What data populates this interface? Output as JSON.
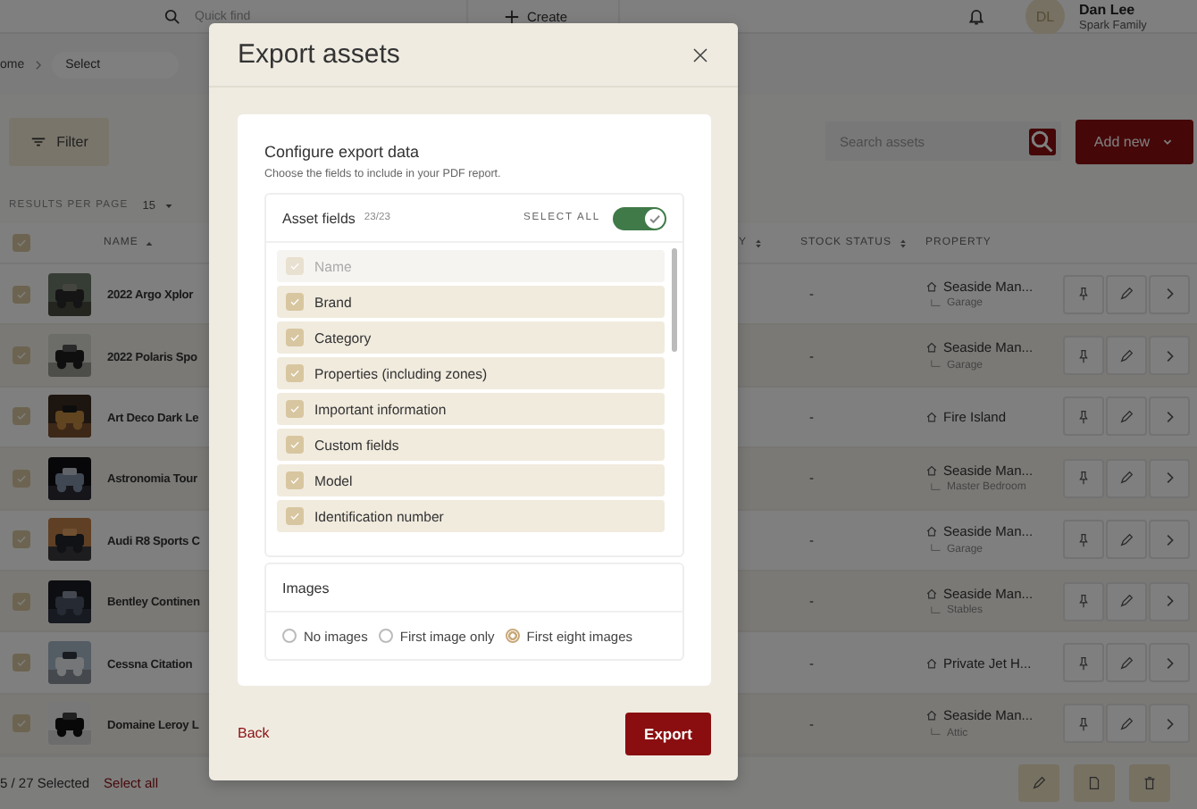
{
  "top_bar": {
    "quick_find_placeholder": "Quick find",
    "create_label": "Create",
    "user": {
      "initials": "DL",
      "name": "Dan Lee",
      "family": "Spark Family"
    }
  },
  "breadcrumb": [
    {
      "label": "ome",
      "current": false
    },
    {
      "label": "Select",
      "current": true
    }
  ],
  "toolbar": {
    "filter_label": "Filter",
    "search_placeholder": "Search assets",
    "add_label": "Add new"
  },
  "results_per_page": {
    "label": "RESULTS PER PAGE",
    "value": "15"
  },
  "table": {
    "header_checked": true,
    "columns": [
      {
        "label": "NAME",
        "sortable": true,
        "sorted": true
      },
      {
        "label": "Y",
        "sortable": true,
        "sorted": false
      },
      {
        "label": "STOCK STATUS",
        "sortable": true,
        "sorted": false
      },
      {
        "label": "PROPERTY",
        "sortable": false
      }
    ],
    "rows": [
      {
        "checked": true,
        "name": "2022 Argo Xplor",
        "stock_status": "-",
        "property": {
          "name": "Seaside Man...",
          "zone": "Garage"
        }
      },
      {
        "checked": true,
        "name": "2022 Polaris Spo",
        "stock_status": "-",
        "property": {
          "name": "Seaside Man...",
          "zone": "Garage"
        }
      },
      {
        "checked": true,
        "name": "Art Deco Dark Le",
        "stock_status": "-",
        "property": {
          "name": "Fire Island"
        }
      },
      {
        "checked": true,
        "name": "Astronomia Tour",
        "stock_status": "-",
        "property": {
          "name": "Seaside Man...",
          "zone": "Master Bedroom"
        }
      },
      {
        "checked": true,
        "name": "Audi R8 Sports C",
        "stock_status": "-",
        "property": {
          "name": "Seaside Man...",
          "zone": "Garage"
        }
      },
      {
        "checked": true,
        "name": "Bentley Continen",
        "stock_status": "-",
        "property": {
          "name": "Seaside Man...",
          "zone": "Stables"
        }
      },
      {
        "checked": true,
        "name": "Cessna Citation",
        "stock_status": "-",
        "property": {
          "name": "Private Jet H..."
        }
      },
      {
        "checked": true,
        "name": "Domaine Leroy L",
        "stock_status": "-",
        "property": {
          "name": "Seaside Man...",
          "zone": "Attic"
        }
      }
    ]
  },
  "selection_bar": {
    "count": "5 / 27 Selected",
    "select_all": "Select all"
  },
  "modal": {
    "title": "Export assets",
    "heading": "Configure export data",
    "description": "Choose the fields to include in your PDF report.",
    "asset_fields": {
      "title": "Asset fields",
      "count": "23/23",
      "select_all_label": "SELECT ALL",
      "select_all_on": true,
      "items": [
        {
          "label": "Name",
          "checked": true,
          "disabled": true
        },
        {
          "label": "Brand",
          "checked": true,
          "disabled": false
        },
        {
          "label": "Category",
          "checked": true,
          "disabled": false
        },
        {
          "label": "Properties (including zones)",
          "checked": true,
          "disabled": false
        },
        {
          "label": "Important information",
          "checked": true,
          "disabled": false
        },
        {
          "label": "Custom fields",
          "checked": true,
          "disabled": false
        },
        {
          "label": "Model",
          "checked": true,
          "disabled": false
        },
        {
          "label": "Identification number",
          "checked": true,
          "disabled": false
        }
      ]
    },
    "images": {
      "title": "Images",
      "options": [
        {
          "label": "No images",
          "selected": false
        },
        {
          "label": "First image only",
          "selected": false
        },
        {
          "label": "First eight images",
          "selected": true
        }
      ]
    },
    "back_label": "Back",
    "export_label": "Export"
  }
}
